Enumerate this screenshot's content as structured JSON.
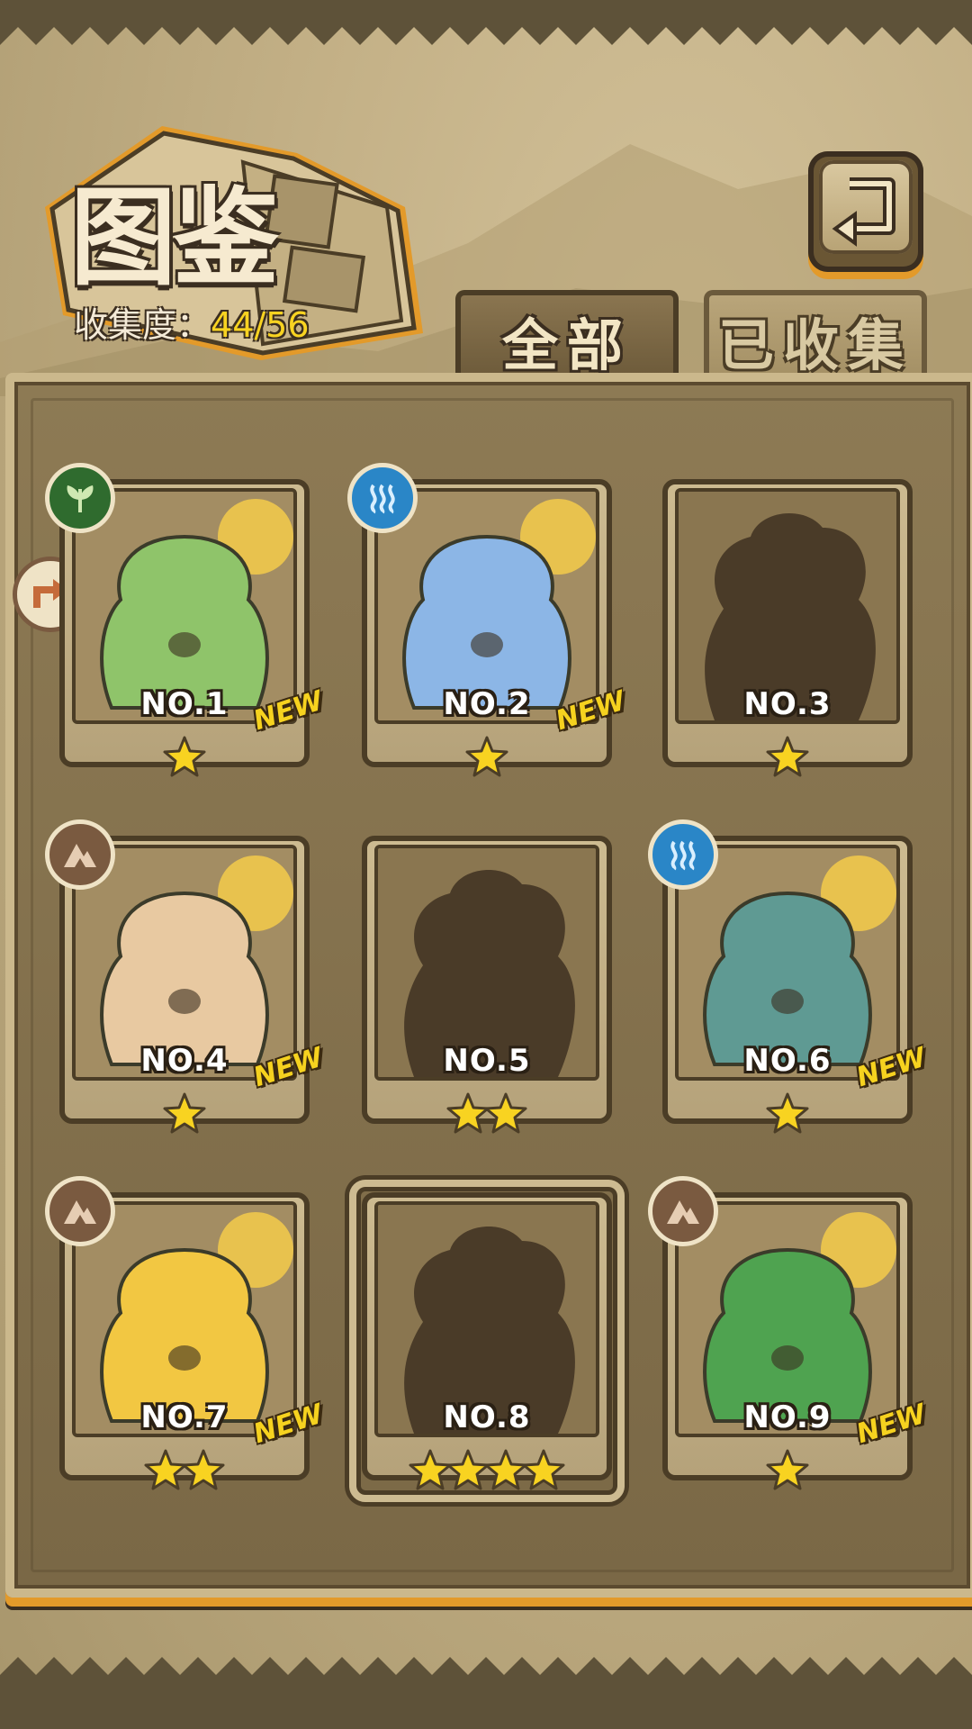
{
  "header": {
    "title": "图鉴",
    "collect_label": "收集度：",
    "collect_value": "44/56"
  },
  "tabs": [
    {
      "label": "全部",
      "active": true
    },
    {
      "label": "已收集",
      "active": false
    }
  ],
  "cards": [
    {
      "number": "NO.1",
      "stars": 1,
      "new": "NEW",
      "element": "plant-icon",
      "silhouette": false,
      "color": "#8fc46a"
    },
    {
      "number": "NO.2",
      "stars": 1,
      "new": "NEW",
      "element": "water-icon",
      "silhouette": false,
      "color": "#8cb6e6"
    },
    {
      "number": "NO.3",
      "stars": 1,
      "new": "",
      "element": "",
      "silhouette": true,
      "color": "#4a3b28"
    },
    {
      "number": "NO.4",
      "stars": 1,
      "new": "NEW",
      "element": "earth-icon",
      "silhouette": false,
      "color": "#e8c9a1"
    },
    {
      "number": "NO.5",
      "stars": 2,
      "new": "",
      "element": "",
      "silhouette": true,
      "color": "#4a3b28"
    },
    {
      "number": "NO.6",
      "stars": 1,
      "new": "NEW",
      "element": "water-icon",
      "silhouette": false,
      "color": "#5f9a93"
    },
    {
      "number": "NO.7",
      "stars": 2,
      "new": "NEW",
      "element": "earth-icon",
      "silhouette": false,
      "color": "#f2c742"
    },
    {
      "number": "NO.8",
      "stars": 4,
      "new": "",
      "element": "",
      "silhouette": true,
      "color": "#4a3b28"
    },
    {
      "number": "NO.9",
      "stars": 1,
      "new": "NEW",
      "element": "earth-icon",
      "silhouette": false,
      "color": "#4fa350"
    }
  ],
  "colors": {
    "accent_orange": "#e39a2a",
    "star_yellow": "#f8d321",
    "new_yellow": "#f6d21f"
  }
}
